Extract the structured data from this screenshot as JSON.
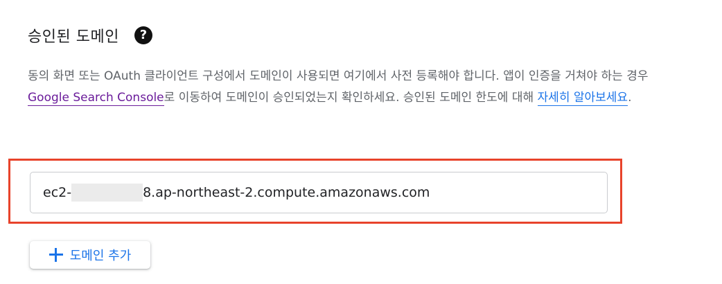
{
  "section": {
    "title": "승인된 도메인",
    "help_icon": "question-circle-icon"
  },
  "description": {
    "text_1": "동의 화면 또는 OAuth 클라이언트 구성에서 도메인이 사용되면 여기에서 사전 등록해야 합니다. 앱이 인증을 거쳐야 하는 경우 ",
    "link_console": "Google Search Console",
    "text_2": "로 이동하여 도메인이 승인되었는지 확인하세요. 승인된 도메인 한도에 대해 ",
    "link_learn_more": "자세히 알아보세요",
    "text_3": "."
  },
  "domain_field": {
    "value_prefix": "ec2-",
    "value_suffix": "8.ap-northeast-2.compute.amazonaws.com"
  },
  "add_button": {
    "label": "도메인 추가",
    "icon": "plus-icon"
  },
  "colors": {
    "highlight_border": "#e8432b",
    "link": "#1a73e8",
    "visited_link": "#6a1b9a",
    "body_text": "#5f6368"
  }
}
